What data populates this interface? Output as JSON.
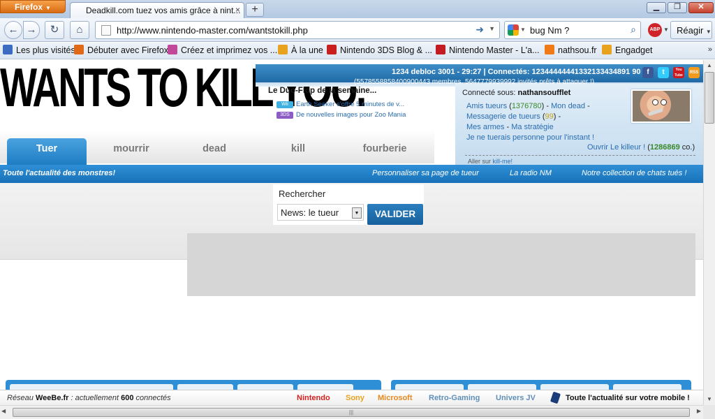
{
  "browser": {
    "app_button": "Firefox",
    "tab_title": "Deadkill.com tuez vos amis grâce à nint...",
    "tab_close": "×",
    "new_tab": "+",
    "url": "http://www.nintendo-master.com/wantstokill.php",
    "search_text": "bug Nm ?",
    "reagir": "Réagir",
    "abp": "ABP",
    "bookmarks": [
      {
        "label": "Les plus visités",
        "icon": "blue-bookmark-icon",
        "color": "#3b6cc1"
      },
      {
        "label": "Débuter avec Firefox",
        "icon": "firefox-icon",
        "color": "#e06a17"
      },
      {
        "label": "Créez et imprimez vos ...",
        "icon": "print-icon",
        "color": "#c2489a"
      },
      {
        "label": "À la une",
        "icon": "rss-icon",
        "color": "#e8a21e"
      },
      {
        "label": "Nintendo 3DS Blog & ...",
        "icon": "mushroom-icon",
        "color": "#c8201e"
      },
      {
        "label": "Nintendo Master - L'a...",
        "icon": "nm-icon",
        "color": "#c21c22"
      },
      {
        "label": "nathsou.fr",
        "icon": "blogger-icon",
        "color": "#f07a16"
      },
      {
        "label": "Engadget",
        "icon": "rss-icon",
        "color": "#e8a21e"
      }
    ],
    "bookmarks_more": "»"
  },
  "site": {
    "logo": "WANTS TO KILL YOU.",
    "stats_line1": "1234 debloc 3001 - 29:27 | Connectés: 12344444441332133434891 90",
    "stats_line2": "(5578558858400900443 membres, 5647779939992 invités prêts à attaquer !)",
    "social": [
      "f",
      "t",
      "You Tube",
      "RSS"
    ],
    "duo": {
      "title": "Le Duo-Flop de la semaine...",
      "items": [
        {
          "badge": "Wii",
          "badge_color": "#3fb0e0",
          "text": "Earth Seeker s'offre 5 minutes de v..."
        },
        {
          "badge": "3DS",
          "badge_color": "#8b5cc4",
          "text": "De nouvelles images pour Zoo Mania"
        }
      ]
    },
    "user": {
      "connecte_label": "Connecté sous:",
      "username": "nathansoufflet",
      "amis_label": "Amis tueurs",
      "amis_count": "1376780",
      "mon_dead": "Mon dead",
      "messagerie_label": "Messagerie de tueurs",
      "messagerie_count": "99",
      "mes_armes": "Mes armes",
      "ma_strategie": "Ma stratégie",
      "no_kill": "Je ne tuerais personne pour l'instant !",
      "ouvrir_label": "Ouvrir Le killeur !",
      "ouvrir_count": "1286869",
      "ouvrir_unit": "co.",
      "aller_prefix": "Aller sur",
      "aller_link": "kill-me!"
    },
    "tabs": [
      "Tuer",
      "mourrir",
      "dead",
      "kill",
      "fourberie"
    ],
    "bluebar": {
      "left": "Toute l'actualité des monstres!",
      "links": [
        "Personnaliser sa page de tueur",
        "La radio NM",
        "Notre collection de chats tués !"
      ]
    },
    "search": {
      "label": "Rechercher",
      "select_value": "News: le tueur",
      "button": "VALIDER"
    },
    "status": {
      "reseau_prefix": "Réseau",
      "reseau_name": "WeeBe.fr",
      "reseau_suffix": ": actuellement",
      "reseau_count": "600",
      "reseau_end": "connectés",
      "links": [
        {
          "label": "Nintendo",
          "color": "#d8201e"
        },
        {
          "label": "Sony",
          "color": "#e8a21e"
        },
        {
          "label": "Microsoft",
          "color": "#e8881e"
        },
        {
          "label": "Retro-Gaming",
          "color": "#5f8fb8"
        },
        {
          "label": "Univers JV",
          "color": "#5f8fb8"
        }
      ],
      "mobile": "Toute l'actualité sur votre mobile !"
    }
  }
}
